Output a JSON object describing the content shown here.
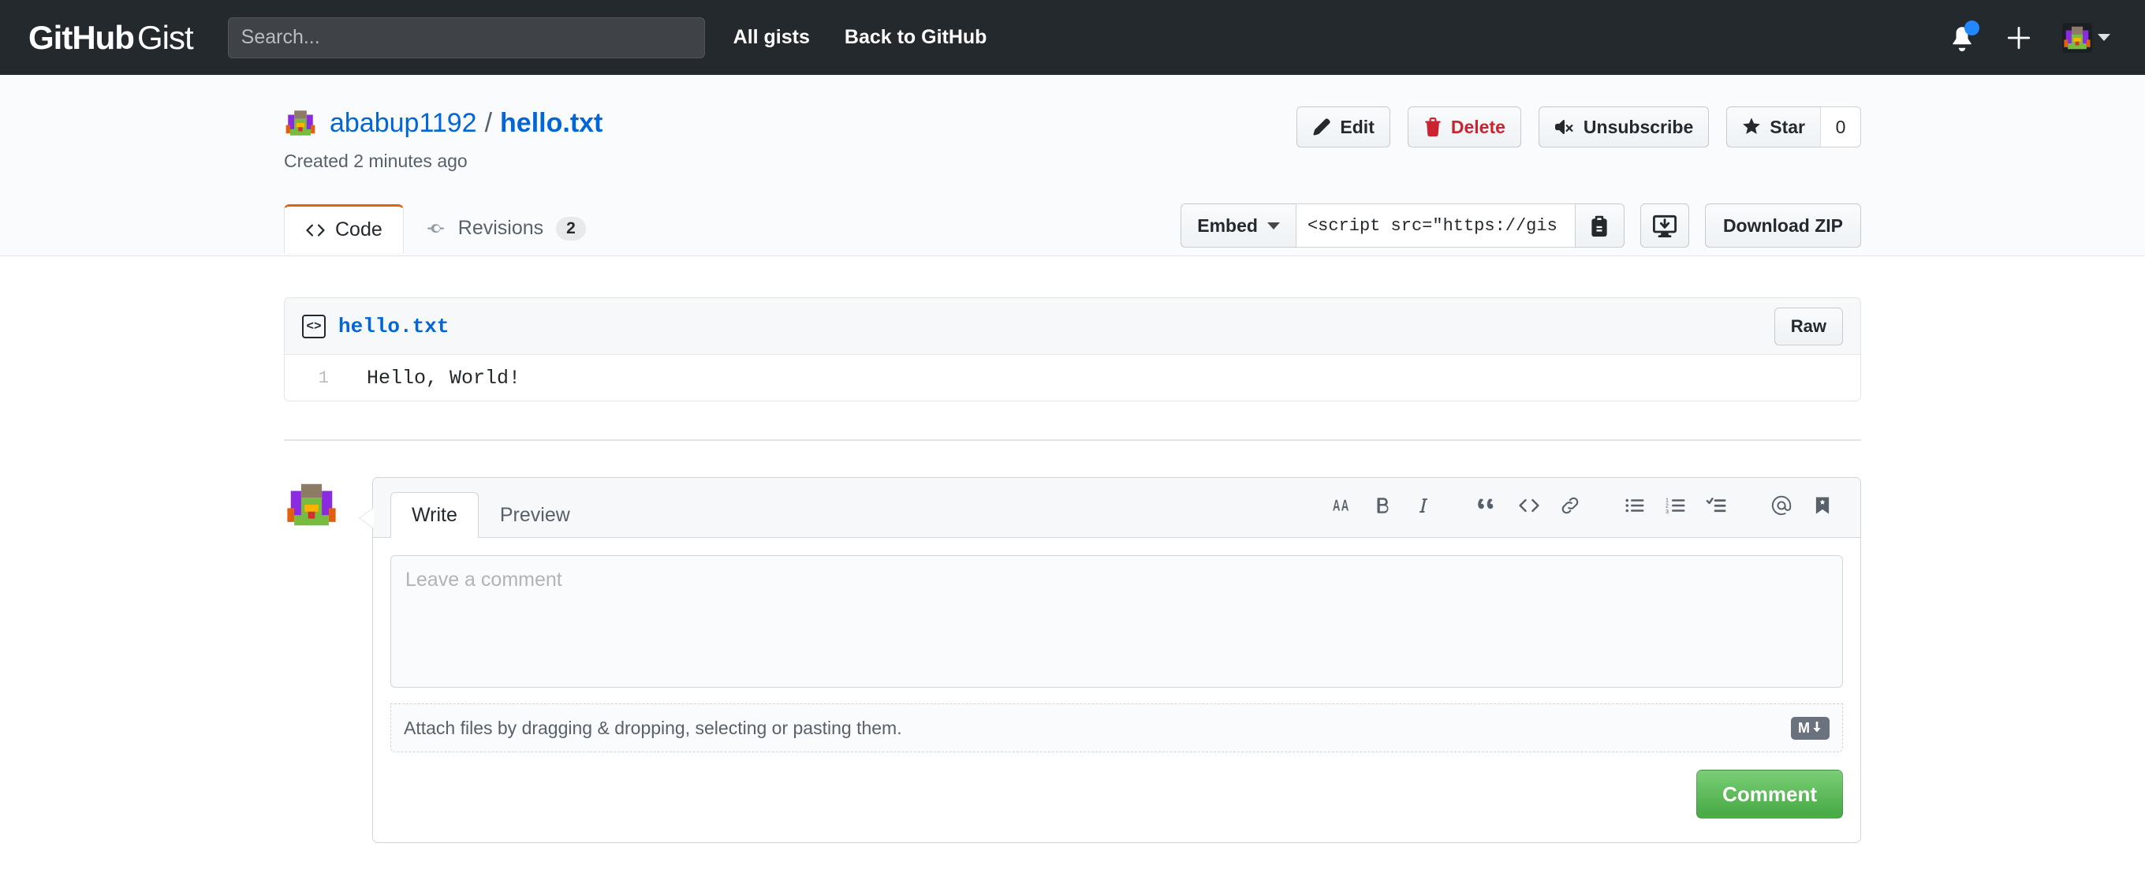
{
  "header": {
    "logo_bold": "GitHub",
    "logo_light": "Gist",
    "search_placeholder": "Search...",
    "nav": [
      {
        "label": "All gists"
      },
      {
        "label": "Back to GitHub"
      }
    ],
    "icons": {
      "notifications": "bell-icon",
      "create_new": "plus-icon",
      "account": "avatar",
      "account_caret": "chevron-down-icon"
    }
  },
  "gist": {
    "owner": "ababup1192",
    "separator": "/",
    "filename": "hello.txt",
    "created": "Created 2 minutes ago",
    "actions": {
      "edit": "Edit",
      "delete": "Delete",
      "unsubscribe": "Unsubscribe",
      "star": "Star",
      "star_count": "0"
    }
  },
  "tabs": [
    {
      "label": "Code",
      "icon": "code-icon",
      "active": true,
      "count": ""
    },
    {
      "label": "Revisions",
      "icon": "git-commit-icon",
      "active": false,
      "count": "2"
    }
  ],
  "embed": {
    "select_label": "Embed",
    "value": "<script src=\"https://gis",
    "copy_icon": "clipboard-copy-icon",
    "desktop_icon": "desktop-download-icon",
    "download_zip": "Download ZIP"
  },
  "file": {
    "icon": "code-file-icon",
    "name": "hello.txt",
    "raw_label": "Raw",
    "lines": [
      {
        "number": "1",
        "text": "Hello, World!"
      }
    ]
  },
  "comment_form": {
    "tabs": [
      {
        "label": "Write",
        "active": true
      },
      {
        "label": "Preview",
        "active": false
      }
    ],
    "toolbar": [
      {
        "name": "heading-icon",
        "glyph": "AA"
      },
      {
        "name": "bold-icon",
        "glyph": "B"
      },
      {
        "name": "italic-icon",
        "glyph": "i"
      },
      {
        "name": "quote-icon",
        "glyph": "“"
      },
      {
        "name": "code-icon",
        "glyph": "<>"
      },
      {
        "name": "link-icon",
        "glyph": "link"
      },
      {
        "name": "unordered-list-icon",
        "glyph": "ul"
      },
      {
        "name": "ordered-list-icon",
        "glyph": "ol"
      },
      {
        "name": "task-list-icon",
        "glyph": "task"
      },
      {
        "name": "mention-icon",
        "glyph": "@"
      },
      {
        "name": "saved-reply-icon",
        "glyph": "bookmark"
      }
    ],
    "textarea_placeholder": "Leave a comment",
    "textarea_value": "",
    "attach_hint": "Attach files by dragging & dropping, selecting or pasting them.",
    "markdown_badge": "M",
    "submit_label": "Comment"
  },
  "colors": {
    "header_bg": "#24292e",
    "link_blue": "#0366d6",
    "danger_red": "#cb2431",
    "tab_accent_orange": "#e36209",
    "submit_green": "#4aab47",
    "notification_blue": "#2188ff",
    "page_bg": "#ffffff",
    "panel_bg": "#fafbfc",
    "border": "#e1e4e8"
  }
}
